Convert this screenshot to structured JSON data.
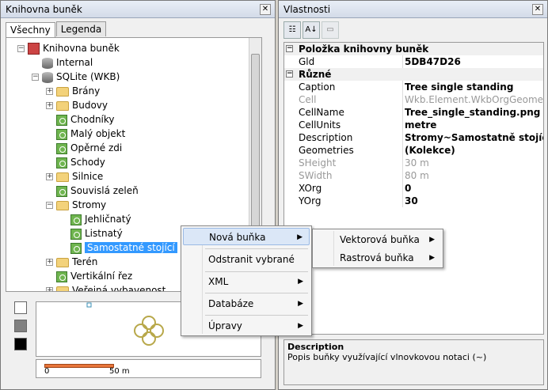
{
  "left_panel": {
    "title": "Knihovna buněk",
    "tabs": [
      "Všechny",
      "Legenda"
    ],
    "tree": [
      {
        "label": "Knihovna buněk",
        "level": 0,
        "icon": "library-icon",
        "expander": "−"
      },
      {
        "label": "Internal",
        "level": 1,
        "icon": "database-icon",
        "expander": ""
      },
      {
        "label": "SQLite (WKB)",
        "level": 1,
        "icon": "database-icon",
        "expander": "−"
      },
      {
        "label": "Brány",
        "level": 2,
        "icon": "folder-icon",
        "expander": "+"
      },
      {
        "label": "Budovy",
        "level": 2,
        "icon": "folder-icon",
        "expander": "+"
      },
      {
        "label": "Chodníky",
        "level": 2,
        "icon": "cell-icon",
        "expander": ""
      },
      {
        "label": "Malý objekt",
        "level": 2,
        "icon": "cell-icon",
        "expander": ""
      },
      {
        "label": "Opěrné zdi",
        "level": 2,
        "icon": "cell-icon",
        "expander": ""
      },
      {
        "label": "Schody",
        "level": 2,
        "icon": "cell-icon",
        "expander": ""
      },
      {
        "label": "Silnice",
        "level": 2,
        "icon": "folder-icon",
        "expander": "+"
      },
      {
        "label": "Souvislá zeleň",
        "level": 2,
        "icon": "cell-icon",
        "expander": ""
      },
      {
        "label": "Stromy",
        "level": 2,
        "icon": "folder-icon",
        "expander": "−"
      },
      {
        "label": "Jehličnatý",
        "level": 3,
        "icon": "cell-icon",
        "expander": ""
      },
      {
        "label": "Listnatý",
        "level": 3,
        "icon": "cell-icon",
        "expander": ""
      },
      {
        "label": "Samostatné stojící",
        "level": 3,
        "icon": "cell-icon",
        "expander": "",
        "selected": true
      },
      {
        "label": "Terén",
        "level": 2,
        "icon": "folder-icon",
        "expander": "+"
      },
      {
        "label": "Vertikální řez",
        "level": 2,
        "icon": "cell-icon",
        "expander": ""
      },
      {
        "label": "Veřejná vybavenost",
        "level": 2,
        "icon": "folder-icon",
        "expander": "+"
      }
    ],
    "scale": {
      "start": "0",
      "end": "50 m"
    },
    "swatch_colors": [
      "#ffffff",
      "#808080",
      "#000000"
    ]
  },
  "right_panel": {
    "title": "Vlastnosti",
    "categories": [
      {
        "name": "Položka knihovny buněk",
        "rows": [
          {
            "key": "Gld",
            "value": "5DB47D26",
            "dim": false
          }
        ]
      },
      {
        "name": "Různé",
        "rows": [
          {
            "key": "Caption",
            "value": "Tree single standing",
            "dim": false
          },
          {
            "key": "Cell",
            "value": "Wkb.Element.WkbOrgGeometry",
            "dim": true
          },
          {
            "key": "CellName",
            "value": "Tree_single_standing.png",
            "dim": false
          },
          {
            "key": "CellUnits",
            "value": "metre",
            "dim": false
          },
          {
            "key": "Description",
            "value": "Stromy~Samostatně stojící",
            "dim": false
          },
          {
            "key": "Geometries",
            "value": "(Kolekce)",
            "dim": false
          },
          {
            "key": "SHeight",
            "value": "30 m",
            "dim": true
          },
          {
            "key": "SWidth",
            "value": "80 m",
            "dim": true
          },
          {
            "key": "XOrg",
            "value": "0",
            "dim": false
          },
          {
            "key": "YOrg",
            "value": "30",
            "dim": false
          }
        ]
      }
    ],
    "description": {
      "title": "Description",
      "text": "Popis buňky využívající vlnovkovou notaci (~)"
    }
  },
  "context_menu": {
    "items": [
      "Nová buňka",
      "Odstranit vybrané",
      "XML",
      "Databáze",
      "Úpravy"
    ],
    "submenu_items": [
      "Vektorová buňka",
      "Rastrová buňka"
    ]
  },
  "colors": {
    "selection": "#3399ff",
    "accent": "#e8763a",
    "cell_green": "#6fb54f"
  }
}
